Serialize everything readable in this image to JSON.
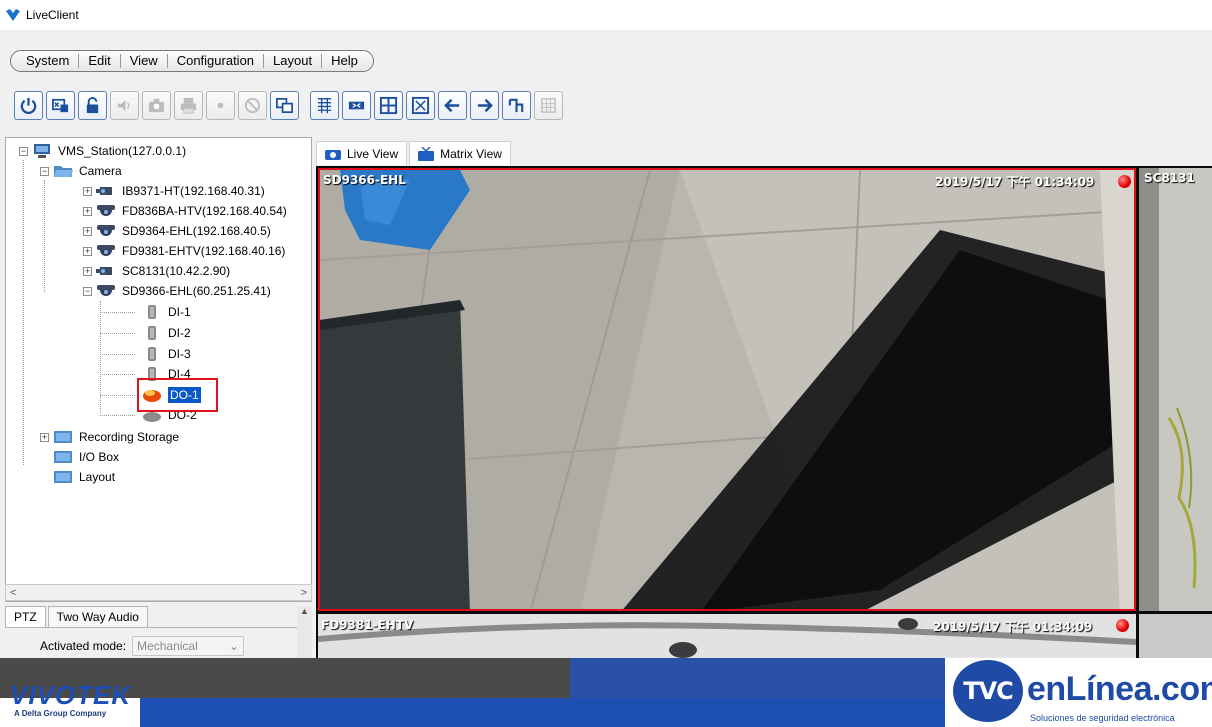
{
  "window": {
    "title": "LiveClient"
  },
  "menu": [
    "System",
    "Edit",
    "View",
    "Configuration",
    "Layout",
    "Help"
  ],
  "toolbar": {
    "buttons": [
      {
        "icon": "power-icon",
        "enabled": true
      },
      {
        "icon": "monitor-connect-icon",
        "enabled": true
      },
      {
        "icon": "unlock-icon",
        "enabled": true
      },
      {
        "icon": "speaker-icon",
        "enabled": false
      },
      {
        "icon": "camera-snapshot-icon",
        "enabled": false
      },
      {
        "icon": "print-icon",
        "enabled": false
      },
      {
        "icon": "record-icon",
        "enabled": false
      },
      {
        "icon": "no-entry-icon",
        "enabled": false
      },
      {
        "icon": "copy-window-icon",
        "enabled": true
      },
      {
        "icon": "grid-small-icon",
        "enabled": true
      },
      {
        "icon": "ptz-icon",
        "enabled": true
      },
      {
        "icon": "layout-2x2-icon",
        "enabled": true
      },
      {
        "icon": "fullscreen-icon",
        "enabled": true
      },
      {
        "icon": "arrow-left-icon",
        "enabled": true
      },
      {
        "icon": "arrow-right-icon",
        "enabled": true
      },
      {
        "icon": "patrol-icon",
        "enabled": true
      },
      {
        "icon": "grid-disabled-icon",
        "enabled": false
      }
    ]
  },
  "tree": {
    "root": "VMS_Station(127.0.0.1)",
    "camera_group": "Camera",
    "cameras": [
      "IB9371-HT(192.168.40.31)",
      "FD836BA-HTV(192.168.40.54)",
      "SD9364-EHL(192.168.40.5)",
      "FD9381-EHTV(192.168.40.16)",
      "SC8131(10.42.2.90)",
      "SD9366-EHL(60.251.25.41)"
    ],
    "io": [
      "DI-1",
      "DI-2",
      "DI-3",
      "DI-4",
      "DO-1",
      "DO-2"
    ],
    "others": [
      "Recording Storage",
      "I/O Box",
      "Layout"
    ]
  },
  "bottom_panel": {
    "tabs": [
      "PTZ",
      "Two Way Audio"
    ],
    "activated_mode_label": "Activated mode:",
    "activated_mode_value": "Mechanical"
  },
  "view_tabs": [
    "Live View",
    "Matrix View"
  ],
  "video": {
    "main_cam_name": "SD9366-EHL",
    "main_timestamp": "2019/5/17 下午 01:34:09",
    "side_cam_name": "SC8131",
    "bottom_cam_name": "FD9381-EHTV",
    "bottom_timestamp": "2019/5/17 下午 01:34:09"
  },
  "branding": {
    "vivotek": "VIVOTEK",
    "vivotek_sub": "A Delta Group Company",
    "tvc": "TVC",
    "enlinea": "enLínea.com",
    "enlinea_sub": "Soluciones de seguridad electrónica"
  },
  "colors": {
    "selection": "#0a58ca",
    "highlight": "#e1131a",
    "accent_blue": "#1f4aa6"
  }
}
